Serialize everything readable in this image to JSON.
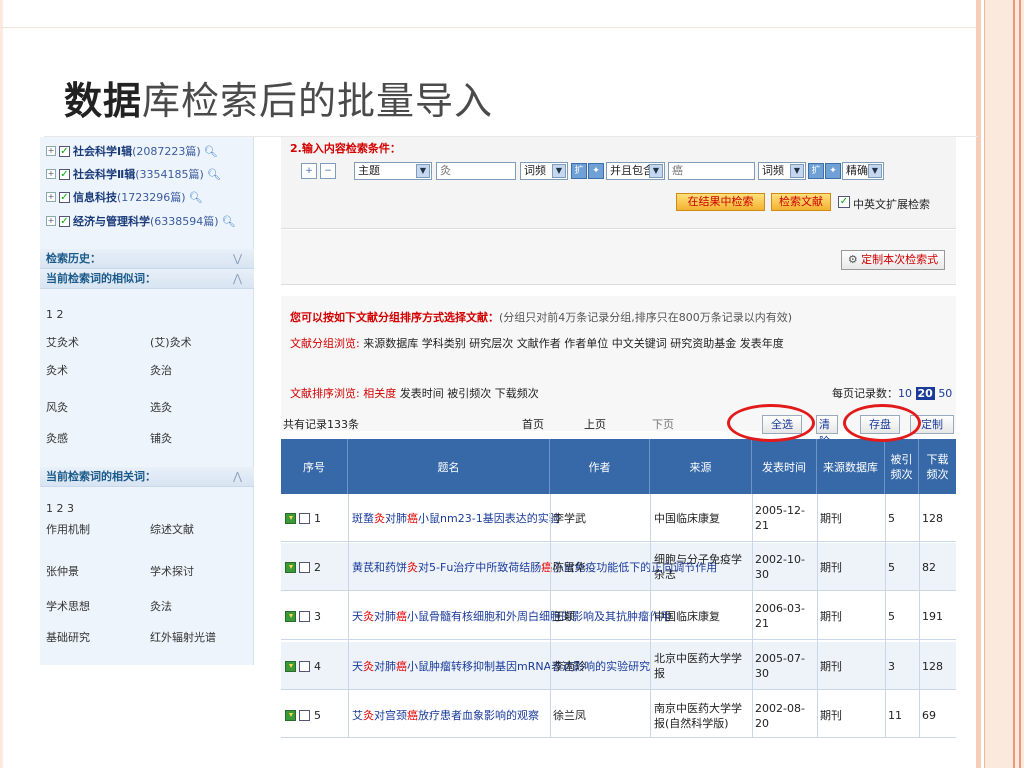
{
  "slide": {
    "title_bold": "数据",
    "title_rest": "库检索后的批量导入"
  },
  "sidebar": {
    "categories": [
      {
        "name": "社会科学Ⅰ辑",
        "count": "(2087223篇)"
      },
      {
        "name": "社会科学Ⅱ辑",
        "count": "(3354185篇)"
      },
      {
        "name": "信息科技",
        "count": "(1723296篇)"
      },
      {
        "name": "经济与管理科学",
        "count": "(6338594篇)"
      }
    ],
    "history_label": "检索历史：",
    "similar_label": "当前检索词的相似词：",
    "similar_pages": "1 2",
    "similar_words": [
      "艾灸术",
      "(艾)灸术",
      "灸术",
      "灸治",
      "风灸",
      "选灸",
      "灸感",
      "铺灸"
    ],
    "related_label": "当前检索词的相关词：",
    "related_pages": "1 2 3",
    "related_words": [
      "作用机制",
      "综述文献",
      "张仲景",
      "学术探讨",
      "学术思想",
      "灸法",
      "基础研究",
      "红外辐射光谱"
    ]
  },
  "search": {
    "cond_label": "2.输入内容检索条件：",
    "field1": "主题",
    "term1": "灸",
    "freq1": "词频",
    "logic": "并且包含",
    "term2": "癌",
    "freq2": "词频",
    "match": "精确",
    "search_in_results": "在结果中检索",
    "search_docs": "检索文献",
    "expand_label": "中英文扩展检索",
    "custom_btn": "定制本次检索式"
  },
  "grouping": {
    "intro_bold": "您可以按如下文献分组排序方式选择文献：",
    "intro_note": "(分组只对前4万条记录分组,排序只在800万条记录以内有效)",
    "group_label": "文献分组浏览:",
    "group_items": "来源数据库  学科类别  研究层次  文献作者  作者单位  中文关键词  研究资助基金  发表年度",
    "sort_label": "文献排序浏览:",
    "sort_active": "相关度",
    "sort_items": "发表时间  被引频次  下载频次",
    "per_page_label": "每页记录数：",
    "per_page_opts": [
      "10",
      "20",
      "50"
    ],
    "total": "共有记录133条",
    "first": "首页",
    "prev": "上页",
    "next": "下页",
    "select_all": "全选",
    "clear": "清除",
    "save": "存盘",
    "custom": "定制"
  },
  "table": {
    "headers": [
      "序号",
      "题名",
      "作者",
      "来源",
      "发表时间",
      "来源数据库",
      "被引频次",
      "下载频次"
    ],
    "rows": [
      {
        "num": "1",
        "title": "斑蝥灸对肺癌小鼠nm23-1基因表达的实验",
        "author": "李学武",
        "source": "中国临床康复",
        "date": "2005-12-21",
        "db": "期刊",
        "cited": "5",
        "downloads": "128"
      },
      {
        "num": "2",
        "title": "黄芪和药饼灸对5-Fu治疗中所致荷结肠癌小鼠免疫功能低下的正向调节作用",
        "author": "陈雪华",
        "source": "细胞与分子免疫学杂志",
        "date": "2002-10-30",
        "db": "期刊",
        "cited": "5",
        "downloads": "82"
      },
      {
        "num": "3",
        "title": "天灸对肺癌小鼠骨髓有核细胞和外周白细胞的影响及其抗肿瘤作用",
        "author": "王颖",
        "source": "中国临床康复",
        "date": "2006-03-21",
        "db": "期刊",
        "cited": "5",
        "downloads": "191"
      },
      {
        "num": "4",
        "title": "天灸对肺癌小鼠肿瘤转移抑制基因mRNA表达影响的实验研究",
        "author": "李南玲",
        "source": "北京中医药大学学报",
        "date": "2005-07-30",
        "db": "期刊",
        "cited": "3",
        "downloads": "128"
      },
      {
        "num": "5",
        "title": "艾灸对宫颈癌放疗患者血象影响的观察",
        "author": "徐兰凤",
        "source": "南京中医药大学学报(自然科学版)",
        "date": "2002-08-20",
        "db": "期刊",
        "cited": "11",
        "downloads": "69"
      }
    ]
  }
}
